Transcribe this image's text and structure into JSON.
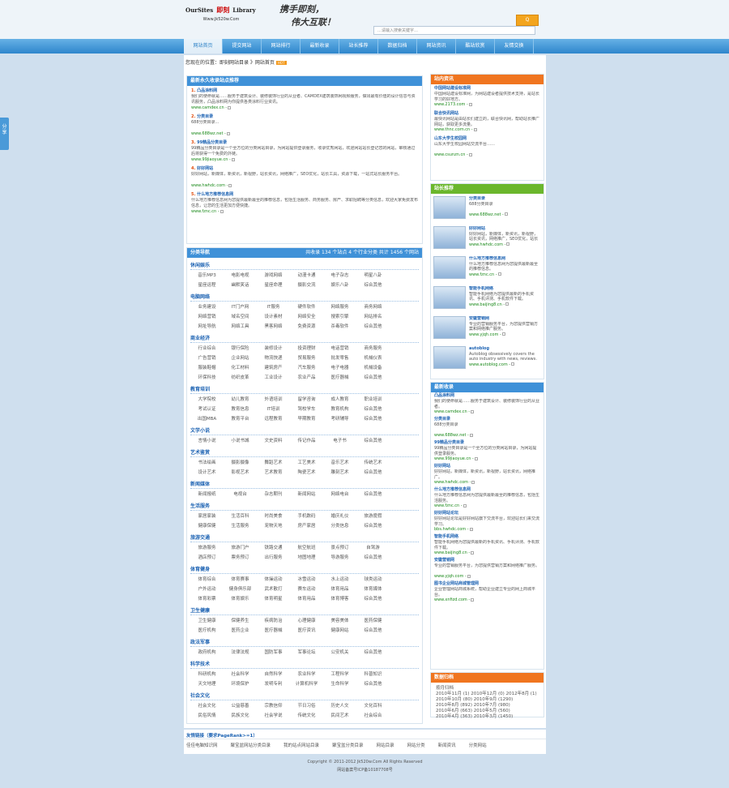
{
  "header": {
    "logo_left": "OurSites",
    "logo_mid": "即刻",
    "logo_right": "Library",
    "logo_url": "Www.Jk520w.Com",
    "slogan1": "携手即刻，",
    "slogan2": "伟大互联！",
    "search_placeholder": "…请输入搜索关键字…",
    "search_button": "Q"
  },
  "nav": [
    "网站首页",
    "提交网站",
    "网站排行",
    "最新收录",
    "站长推荐",
    "数据归档",
    "网站资讯",
    "酷站欣赏",
    "友情交换"
  ],
  "breadcrumb": {
    "text": "您现在的位置：即刻网站目录 》网站首页",
    "badge": "HOT"
  },
  "recommend": {
    "title": "最新永久收录站点推荐",
    "items": [
      {
        "num": "1.",
        "name": "凸品涂料网",
        "desc": "我们的使命就是……服务于建筑设计、装修装饰行业的从业者、CAMDEX建筑装饰网视频服务，做出最有价值的设计信息与资讯服务，凸品涂料网为你提供各类涂料行业资讯。",
        "url": "www.camdex.cn -"
      },
      {
        "num": "2.",
        "name": "分类目录",
        "desc": "688分类目录...",
        "url": "www.688wz.net -"
      },
      {
        "num": "3.",
        "name": "99精品分类目录",
        "desc": "99精品分类目录是一个全方位的分类网站目录，为网站提供登录服务，收录优秀网站，欢迎网站站长登记您的网站，审核通过后将获得一个免费的外链。",
        "url": "www.99jiaoyue.cn -"
      },
      {
        "num": "4.",
        "name": "好好网站",
        "desc": "好好网站，新媒体，新资讯，新视野，站长资讯，网络推广，SEO优化，站长工具，资源下载，一站式站长服务平台。",
        "url": "www.hwhdc.com -"
      },
      {
        "num": "5.",
        "name": "什么地方推荐信息网",
        "desc": "什么地方推荐信息网为您提供最新最全的推荐信息，包括生活服务、商务服务、房产、求职招聘等分类信息，欢迎大家免费发布信息，让您的生活更加方便快捷。",
        "url": "www.fznc.cn -"
      }
    ]
  },
  "categories": {
    "title": "分类导航",
    "stats": "共收录 134 个站点  4 个行业分类  共计 1456 个网站",
    "groups": [
      {
        "name": "休闲娱乐",
        "rows": [
          [
            "音乐MP3",
            "电影电视",
            "游戏网络",
            "动漫卡通",
            "电子杂志",
            "明星八卦"
          ],
          [
            "星座运程",
            "幽默笑话",
            "星座命理",
            "摄影交流",
            "娱乐八卦",
            "综合其他"
          ]
        ]
      },
      {
        "name": "电脑网络",
        "rows": [
          [
            "业务建设",
            "IT门户网",
            "IT服务",
            "硬件软件",
            "网络服务",
            "商务网络"
          ],
          [
            "网络营销",
            "域名空间",
            "设计素材",
            "网络安全",
            "搜索引擎",
            "网站排名"
          ],
          [
            "网址导航",
            "网络工具",
            "黑客网络",
            "免费资源",
            "杀毒软件",
            "综合其他"
          ]
        ]
      },
      {
        "name": "商业经济",
        "rows": [
          [
            "行业综合",
            "银行保险",
            "装修设计",
            "投资理财",
            "电话营销",
            "商务服务"
          ],
          [
            "广告营销",
            "企业网站",
            "物流快递",
            "贸易服务",
            "批发零售",
            "机械仪表"
          ],
          [
            "服装鞋帽",
            "化工材料",
            "建筑房产",
            "汽车服务",
            "电子电器",
            "机械设备"
          ],
          [
            "环保科技",
            "纺织皮革",
            "工业设计",
            "农业产品",
            "医疗器械",
            "综合其他"
          ]
        ]
      },
      {
        "name": "教育培训",
        "rows": [
          [
            "大学院校",
            "幼儿教育",
            "外语培训",
            "留学咨询",
            "成人教育",
            "职业培训"
          ],
          [
            "考试认证",
            "教育信息",
            "IT培训",
            "驾校学车",
            "教育机构",
            "综合其他"
          ],
          [
            "出国MBA",
            "教育平台",
            "远程教育",
            "早期教育",
            "考研辅导",
            "综合其他"
          ]
        ]
      },
      {
        "name": "文学小说",
        "rows": [
          [
            "言情小说",
            "小说书城",
            "文史资料",
            "传记作品",
            "电子书",
            "综合其他"
          ]
        ]
      },
      {
        "name": "艺术鉴赏",
        "rows": [
          [
            "书法绘画",
            "摄影摄像",
            "舞蹈艺术",
            "工艺美术",
            "音乐艺术",
            "传统艺术"
          ],
          [
            "设计艺术",
            "影视艺术",
            "艺术教育",
            "陶瓷艺术",
            "雕刻艺术",
            "综合其他"
          ]
        ]
      },
      {
        "name": "新闻媒体",
        "rows": [
          [
            "新闻报纸",
            "电视台",
            "杂志期刊",
            "新闻网站",
            "网络电台",
            "综合其他"
          ]
        ]
      },
      {
        "name": "生活服务",
        "rows": [
          [
            "家居家装",
            "生活百科",
            "时尚美食",
            "手机数码",
            "婚庆礼仪",
            "旅游度假"
          ],
          [
            "健康保健",
            "生活服务",
            "宠物天地",
            "房产家居",
            "分类信息",
            "综合其他"
          ]
        ]
      },
      {
        "name": "旅游交通",
        "rows": [
          [
            "旅游服务",
            "旅游门户",
            "铁路交通",
            "航空航班",
            "景点预订",
            "自驾游"
          ],
          [
            "酒店预订",
            "票务预订",
            "出行服务",
            "地图地理",
            "导游服务",
            "综合其他"
          ]
        ]
      },
      {
        "name": "体育健身",
        "rows": [
          [
            "体育综合",
            "体育赛事",
            "体操运动",
            "冰雪运动",
            "水上运动",
            "球类运动"
          ],
          [
            "户外运动",
            "健身俱乐部",
            "武术散打",
            "赛车运动",
            "体育用品",
            "体育媒体"
          ],
          [
            "体育彩票",
            "体育娱乐",
            "体育明星",
            "体育用品",
            "体育博客",
            "综合其他"
          ]
        ]
      },
      {
        "name": "卫生健康",
        "rows": [
          [
            "卫生健康",
            "保健养生",
            "疾病防治",
            "心理健康",
            "美容美体",
            "医药保健"
          ],
          [
            "医疗机构",
            "医药企业",
            "医疗器械",
            "医疗资讯",
            "健康网站",
            "综合其他"
          ]
        ]
      },
      {
        "name": "政法军事",
        "rows": [
          [
            "政府机构",
            "法律法规",
            "国防军事",
            "军事论坛",
            "公安机关",
            "综合其他"
          ]
        ]
      },
      {
        "name": "科学技术",
        "rows": [
          [
            "科研机构",
            "社会科学",
            "自然科学",
            "农业科学",
            "工程科学",
            "科普知识"
          ],
          [
            "天文地理",
            "环境保护",
            "发明专利",
            "计算机科学",
            "生命科学",
            "综合其他"
          ]
        ]
      },
      {
        "name": "社会文化",
        "rows": [
          [
            "社会文化",
            "公益慈善",
            "宗教信仰",
            "节日习俗",
            "历史人文",
            "文化百科"
          ],
          [
            "民俗风情",
            "民族文化",
            "社会学说",
            "传统文化",
            "民间艺术",
            "社会综合"
          ]
        ]
      }
    ]
  },
  "side_latest": {
    "title": "站内资讯",
    "items": [
      {
        "name": "中国网站建设标准网",
        "desc": "中国网站建设标准网，为网站建设者提供技术支持，是站长学习的好地方。",
        "url": "www.2173.com -"
      },
      {
        "name": "联合快讯网站",
        "desc": "最快讯网站是由站长们建立的，联合快讯网，帮助站长推广网站，获取更多流量。",
        "url": "www.thnc.com.cn -"
      },
      {
        "name": "山东大学生校园网",
        "desc": "山东大学生校园网站交流平台……",
        "url": "www.csunzn.cn -"
      }
    ]
  },
  "side_recommend": {
    "title": "站长推荐",
    "items": [
      {
        "name": "分类目录",
        "desc": "688分类目录",
        "url": "www.688wz.net -"
      },
      {
        "name": "好好网站",
        "desc": "好好网站，新媒体，新资讯，新视野，站长资讯，网络推广，SEO优化，站长工具。",
        "url": "www.hwhdc.com -"
      },
      {
        "name": "什么地方推荐信息网",
        "desc": "什么地方推荐信息网为您提供最新最全的推荐信息。",
        "url": "www.fznc.cn -"
      },
      {
        "name": "智能手机网络",
        "desc": "智能手机网络为您提供最新的手机资讯、手机评测、手机软件下载。",
        "url": "www.baijing8.cn -"
      },
      {
        "name": "安徽营销网",
        "desc": "专业的营销服务平台，为您提供营销方案和网络推广服务。",
        "url": "www.yjqh.com -"
      },
      {
        "name": "autoblog",
        "desc": "Autoblog obsessively covers the auto industry with news, reviews.",
        "url": "www.autoblog.com -"
      }
    ]
  },
  "side_newest": {
    "title": "最新收录",
    "items": [
      {
        "name": "凸品涂料网",
        "desc": "我们的使命就是……服务于建筑设计、装修装饰行业的从业者。",
        "url": "www.camdex.cn -"
      },
      {
        "name": "分类目录",
        "desc": "688分类目录",
        "url": "www.688wz.net -"
      },
      {
        "name": "99精品分类目录",
        "desc": "99精品分类目录是一个全方位的分类网站目录，为网站提供登录服务。",
        "url": "www.99jiaoyue.cn -"
      },
      {
        "name": "好好网站",
        "desc": "好好网站，新媒体，新资讯，新视野，站长资讯，网络推广。",
        "url": "www.hwhdc.com -"
      },
      {
        "name": "什么地方推荐信息网",
        "desc": "什么地方推荐信息网为您提供最新最全的推荐信息，包括生活服务。",
        "url": "www.fznc.cn -"
      },
      {
        "name": "好好网站论坛",
        "desc": "好好网站论坛是好好网站旗下交流平台，欢迎站长们来交流学习。",
        "url": "bbs.hwhdc.com -"
      },
      {
        "name": "智能手机网络",
        "desc": "智能手机网络为您提供最新的手机资讯、手机评测、手机软件下载。",
        "url": "www.baijing8.cn -"
      },
      {
        "name": "安徽营销网",
        "desc": "专业的营销服务平台，为您提供营销方案和网络推广服务。",
        "url": "www.yjqh.com -"
      },
      {
        "name": "图书企业网站商城管理网",
        "desc": "企业管理网站商城系统，帮助企业建立专业的网上商城平台。",
        "url": "www.xnfizd.com -"
      }
    ]
  },
  "archive": {
    "title": "数据归档",
    "lines": [
      "按月归档",
      "2010年11月 (1)  2010年12月 (0)  2012年8月 (1)",
      "2010年10月 (80)  2010年9月 (1290)",
      "2010年8月 (892)  2010年7月 (980)",
      "2010年6月 (663)  2010年5月 (560)",
      "2010年4月 (363)  2010年3月 (1450)"
    ]
  },
  "links": {
    "title": "友情链接（要求PageRank>=1）",
    "items": [
      "佳佳电脑知识网",
      "聚宝盆网站分类目录",
      "我的站点网站目录",
      "聚宝盆分类目录",
      "网站目录",
      "网站分类",
      "新闻资讯",
      "分类网站"
    ]
  },
  "footer": {
    "copyright": "Copyright © 2011-2012 Jk520w.Com All Rights Reserved",
    "icp": "网站备案号ICP备10187708号"
  },
  "share": "分享"
}
